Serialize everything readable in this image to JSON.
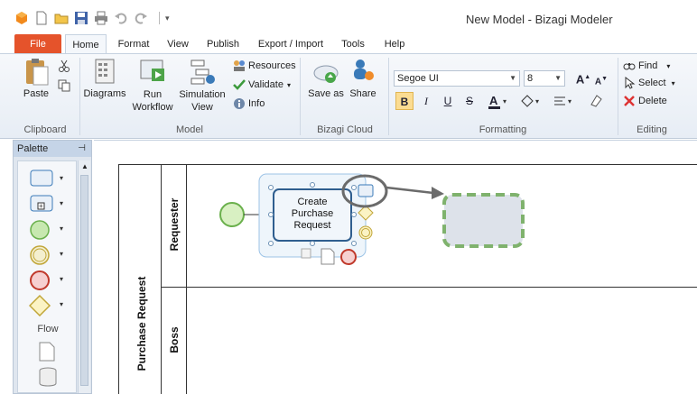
{
  "app": {
    "title": "New Model - Bizagi Modeler"
  },
  "menu": {
    "tabs": [
      "File",
      "Home",
      "Format",
      "View",
      "Publish",
      "Export / Import",
      "Tools",
      "Help"
    ]
  },
  "ribbon": {
    "clipboard": {
      "paste": "Paste",
      "label": "Clipboard"
    },
    "model": {
      "diagrams": "Diagrams",
      "run_workflow_1": "Run",
      "run_workflow_2": "Workflow",
      "simulation_view_1": "Simulation",
      "simulation_view_2": "View",
      "resources": "Resources",
      "validate": "Validate",
      "info": "Info",
      "label": "Model"
    },
    "cloud": {
      "save_as": "Save as",
      "share": "Share",
      "label": "Bizagi Cloud"
    },
    "formatting": {
      "font_family": "Segoe UI",
      "font_size": "8",
      "bold": "B",
      "italic": "I",
      "underline": "U",
      "strike": "S",
      "label": "Formatting"
    },
    "editing": {
      "find": "Find",
      "select": "Select",
      "delete": "Delete",
      "label": "Editing"
    }
  },
  "palette": {
    "title": "Palette",
    "section": "Flow"
  },
  "diagram": {
    "pool_name": "Purchase Request",
    "lanes": [
      "Requester",
      "Boss"
    ],
    "task_label": "Create\nPurchase\nRequest",
    "accent": "#3a7ab8",
    "green": "#6ab04c"
  }
}
